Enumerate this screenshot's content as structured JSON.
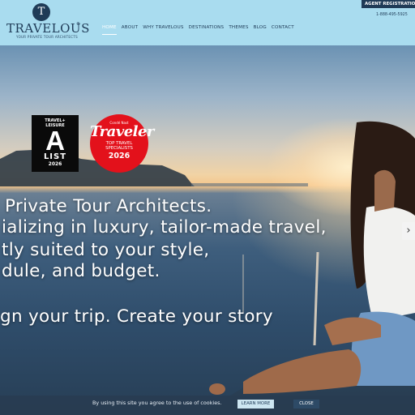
{
  "header": {
    "logo_initial": "T",
    "logo_text": "TRAVELOUS",
    "logo_registered": "®",
    "logo_tagline": "YOUR PRIVATE TOUR ARCHITECTS",
    "agent_button": "AGENT REGISTRATION",
    "phone": "1-888-495-5925",
    "nav": [
      {
        "label": "HOME",
        "active": true
      },
      {
        "label": "ABOUT"
      },
      {
        "label": "WHY TRAVELOUS"
      },
      {
        "label": "DESTINATIONS"
      },
      {
        "label": "THEMES"
      },
      {
        "label": "BLOG"
      },
      {
        "label": "CONTACT"
      }
    ]
  },
  "badges": {
    "travel_leisure": {
      "top": "TRAVEL+",
      "top2": "LEISURE",
      "letter": "A",
      "list": "LIST",
      "year": "2026"
    },
    "conde_nast": {
      "brand": "Condé Nast",
      "name": "Traveler",
      "line1": "TOP TRAVEL",
      "line2": "SPECIALISTS",
      "year": "2026"
    }
  },
  "hero": {
    "line1": "Private Tour Architects.",
    "line2": "ializing in luxury, tailor-made travel,",
    "line3": "tly suited to your style,",
    "line4": "dule, and budget.",
    "line5": "gn your trip. Create your story",
    "next_icon": "›"
  },
  "cookie": {
    "text": "By using this site you agree to the use of cookies.",
    "learn_more": "LEARN MORE",
    "close": "CLOSE"
  }
}
